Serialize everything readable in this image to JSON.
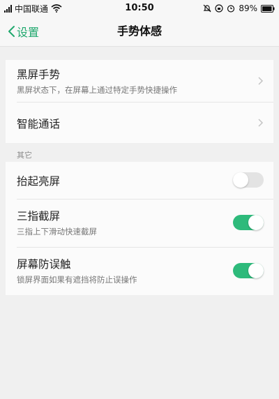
{
  "status": {
    "carrier": "中国联通",
    "time": "10:50",
    "battery": "89%"
  },
  "nav": {
    "back_label": "设置",
    "title": "手势体感"
  },
  "group1": {
    "items": [
      {
        "title": "黑屏手势",
        "subtitle": "黑屏状态下，在屏幕上通过特定手势快捷操作"
      },
      {
        "title": "智能通话"
      }
    ]
  },
  "section_other": "其它",
  "group2": {
    "items": [
      {
        "title": "抬起亮屏",
        "enabled": false
      },
      {
        "title": "三指截屏",
        "subtitle": "三指上下滑动快速截屏",
        "enabled": true
      },
      {
        "title": "屏幕防误触",
        "subtitle": "锁屏界面如果有遮挡将防止误操作",
        "enabled": true
      }
    ]
  },
  "colors": {
    "accent": "#20a86e",
    "toggle_on": "#2eba7b",
    "toggle_off": "#e3e3e3"
  }
}
